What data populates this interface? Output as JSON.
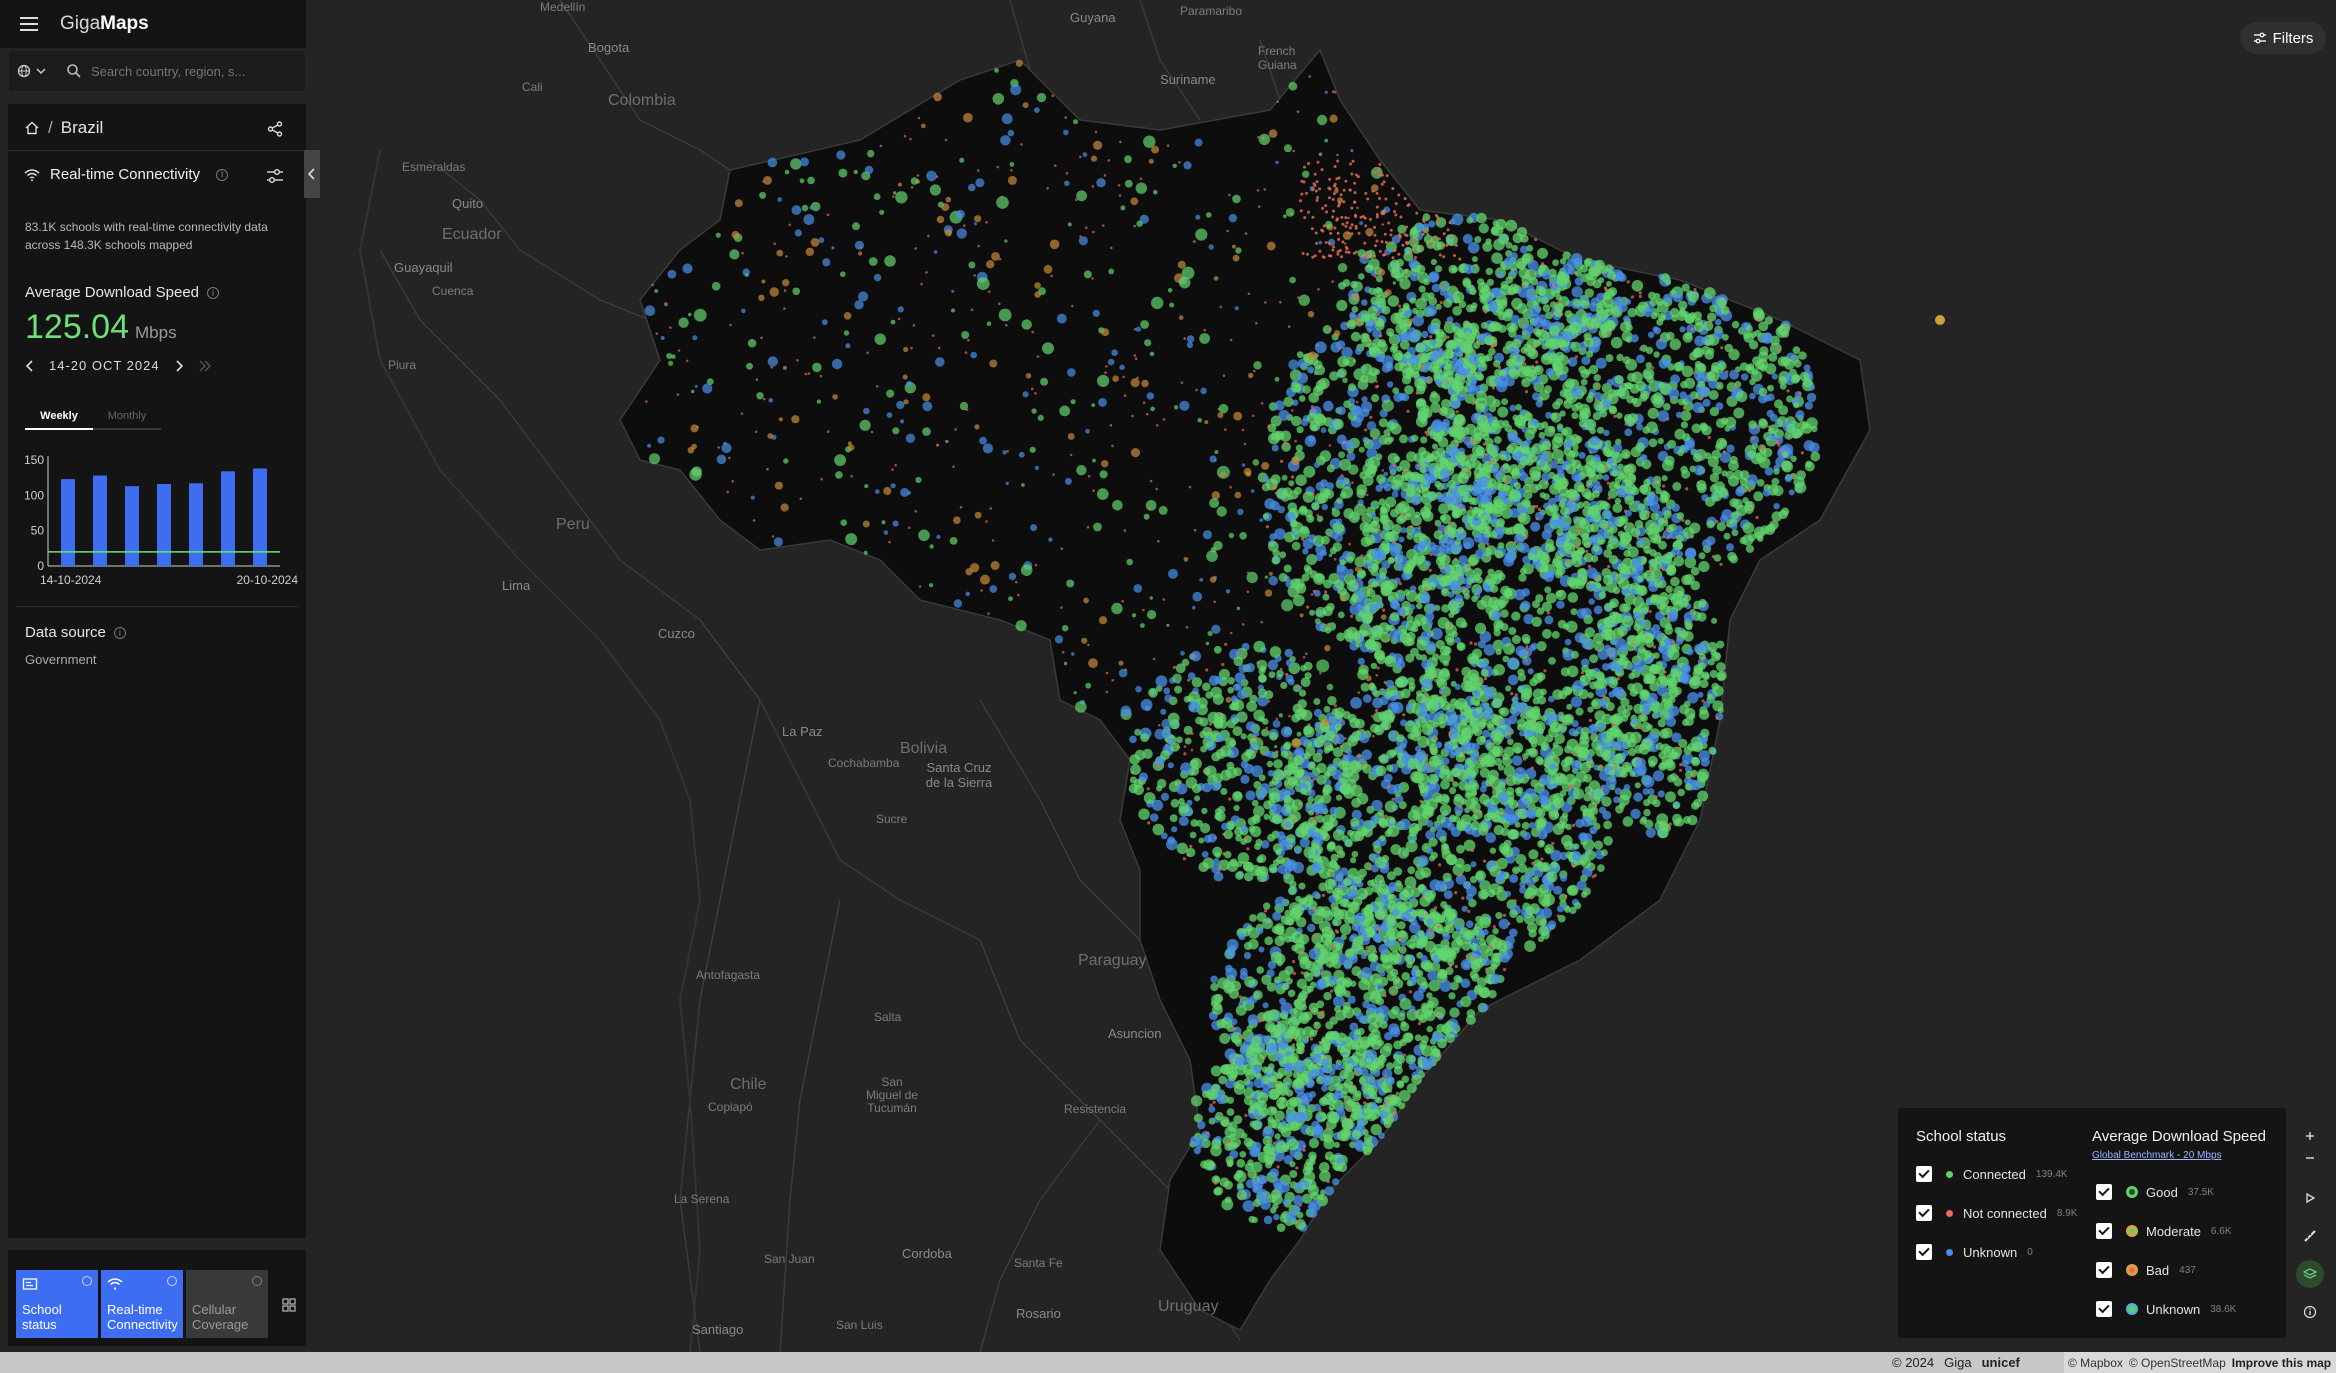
{
  "app": {
    "brand_light": "Giga",
    "brand_bold": "Maps"
  },
  "search": {
    "placeholder": "Search country, region, s..."
  },
  "breadcrumb": {
    "separator": "/",
    "country": "Brazil"
  },
  "layer": {
    "title": "Real-time Connectivity",
    "description": "83.1K schools with real-time connectivity data across 148.3K schools mapped",
    "avg_label": "Average Download Speed",
    "avg_value": "125.04",
    "avg_unit": "Mbps",
    "date_range": "14-20 OCT 2024",
    "tabs": [
      "Weekly",
      "Monthly"
    ],
    "active_tab": "Weekly",
    "data_source_label": "Data source",
    "data_source_value": "Government"
  },
  "chart_data": {
    "type": "bar",
    "categories": [
      "14-10-2024",
      "15-10-2024",
      "16-10-2024",
      "17-10-2024",
      "18-10-2024",
      "19-10-2024",
      "20-10-2024"
    ],
    "values": [
      123,
      128,
      113,
      116,
      117,
      134,
      138
    ],
    "x_tick_labels": [
      "14-10-2024",
      "20-10-2024"
    ],
    "yticks": [
      0,
      50,
      100,
      150
    ],
    "ylim": [
      0,
      150
    ],
    "benchmark": 20,
    "bar_color": "#3d6ef2",
    "benchmark_color": "#6ee079"
  },
  "tiles": [
    {
      "label": "School status",
      "state": "on",
      "icon": "school-icon"
    },
    {
      "label": "Real-time Connectivity",
      "state": "on",
      "icon": "wifi-icon"
    },
    {
      "label": "Cellular Coverage",
      "state": "off",
      "icon": "cell-tower-icon"
    }
  ],
  "filters": {
    "label": "Filters"
  },
  "legend": {
    "school_status_title": "School status",
    "school_status": [
      {
        "label": "Connected",
        "count": "139.4K",
        "color": "#5fd16b"
      },
      {
        "label": "Not connected",
        "count": "8.9K",
        "color": "#ef6a5a"
      },
      {
        "label": "Unknown",
        "count": "0",
        "color": "#4a8cf0"
      }
    ],
    "speed_title": "Average Download Speed",
    "benchmark_link": "Global Benchmark - 20 Mbps",
    "speed": [
      {
        "label": "Good",
        "count": "37.5K",
        "color": "#5fd16b"
      },
      {
        "label": "Moderate",
        "count": "6.6K",
        "color": "#d9a441"
      },
      {
        "label": "Bad",
        "count": "437",
        "color": "#ef6a5a"
      },
      {
        "label": "Unknown",
        "count": "38.6K",
        "color": "#4fb7c7"
      }
    ]
  },
  "map_labels": {
    "countries": [
      "Colombia",
      "Ecuador",
      "Peru",
      "Bolivia",
      "Paraguay",
      "Chile",
      "Uruguay",
      "Guyana",
      "Suriname",
      "French Guiana"
    ],
    "cities": [
      "Medellín",
      "Bogota",
      "Cali",
      "Esmeraldas",
      "Quito",
      "Guayaquil",
      "Cuenca",
      "Piura",
      "Lima",
      "Cuzco",
      "La Paz",
      "Cochabamba",
      "Santa Cruz de la Sierra",
      "Sucre",
      "Antofagasta",
      "Salta",
      "San Miguel de Tucumán",
      "Asuncion",
      "Resistencia",
      "Copiapó",
      "La Serena",
      "San Juan",
      "Cordoba",
      "Santa Fe",
      "Rosario",
      "Santiago",
      "San Luis",
      "Paramaribo"
    ]
  },
  "footer": {
    "copyright": "© 2024",
    "giga": "Giga",
    "unicef": "unicef",
    "mapbox": "© Mapbox",
    "osm": "© OpenStreetMap",
    "improve": "Improve this map"
  }
}
